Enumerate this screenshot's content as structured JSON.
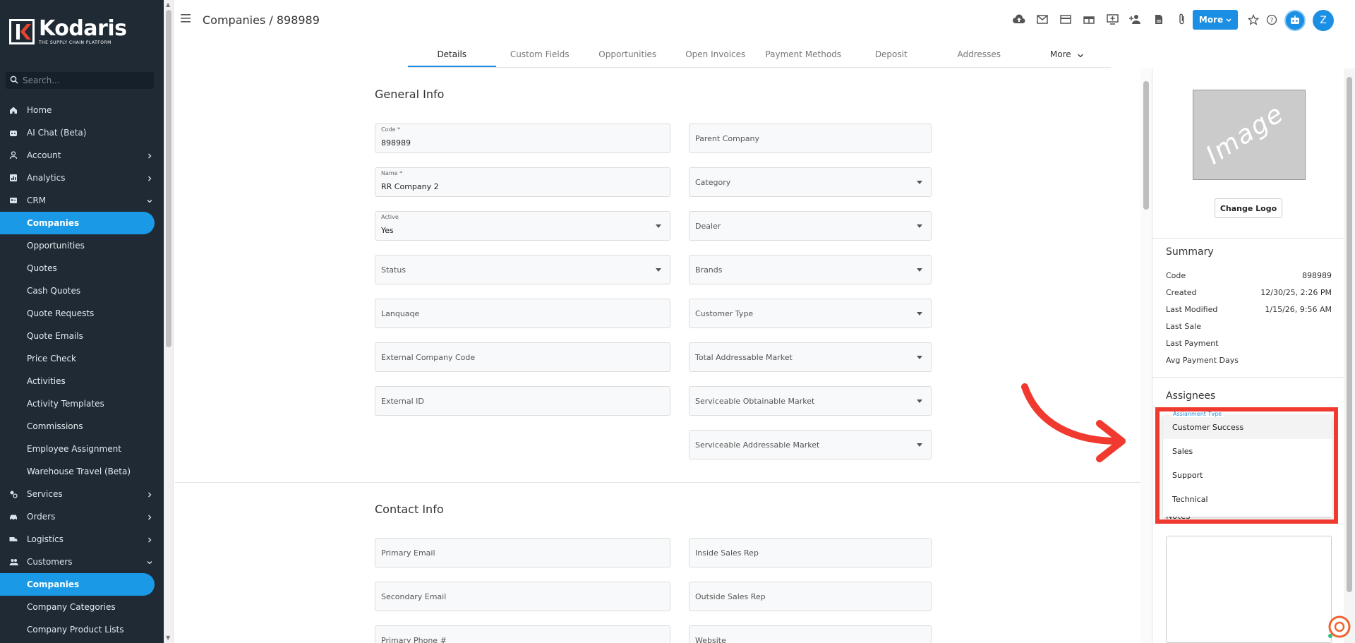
{
  "app": {
    "brand_name": "Kodaris",
    "brand_tagline": "THE SUPPLY CHAIN PLATFORM",
    "page_title": "Companies / 898989",
    "user_initial": "Z",
    "accent_color": "#1a8fe3"
  },
  "sidebar": {
    "search_placeholder": "Search...",
    "items": [
      {
        "label": "Home",
        "icon": "home-icon",
        "type": "top"
      },
      {
        "label": "AI Chat (Beta)",
        "icon": "robot-icon",
        "type": "top"
      },
      {
        "label": "Account",
        "icon": "person-icon",
        "type": "top",
        "chevron": "right"
      },
      {
        "label": "Analytics",
        "icon": "chart-icon",
        "type": "top",
        "chevron": "right"
      },
      {
        "label": "CRM",
        "icon": "contact-card-icon",
        "type": "top",
        "chevron": "down"
      },
      {
        "label": "Companies",
        "type": "sub",
        "active": true
      },
      {
        "label": "Opportunities",
        "type": "sub"
      },
      {
        "label": "Quotes",
        "type": "sub"
      },
      {
        "label": "Cash Quotes",
        "type": "sub"
      },
      {
        "label": "Quote Requests",
        "type": "sub"
      },
      {
        "label": "Quote Emails",
        "type": "sub"
      },
      {
        "label": "Price Check",
        "type": "sub"
      },
      {
        "label": "Activities",
        "type": "sub"
      },
      {
        "label": "Activity Templates",
        "type": "sub"
      },
      {
        "label": "Commissions",
        "type": "sub"
      },
      {
        "label": "Employee Assignment",
        "type": "sub"
      },
      {
        "label": "Warehouse Travel (Beta)",
        "type": "sub"
      },
      {
        "label": "Services",
        "icon": "services-icon",
        "type": "top",
        "chevron": "right"
      },
      {
        "label": "Orders",
        "icon": "car-icon",
        "type": "top",
        "chevron": "right"
      },
      {
        "label": "Logistics",
        "icon": "truck-icon",
        "type": "top",
        "chevron": "right"
      },
      {
        "label": "Customers",
        "icon": "people-icon",
        "type": "top",
        "chevron": "down"
      },
      {
        "label": "Companies",
        "type": "sub",
        "active": true
      },
      {
        "label": "Company Categories",
        "type": "sub"
      },
      {
        "label": "Company Product Lists",
        "type": "sub"
      }
    ]
  },
  "header": {
    "more_label": "More",
    "icons": [
      "cloud-upload-icon",
      "mail-icon",
      "payment-card-icon",
      "gift-box-icon",
      "monitor-icon",
      "add-person-icon",
      "document-icon",
      "paperclip-icon"
    ]
  },
  "tabs": [
    {
      "label": "Details",
      "active": true
    },
    {
      "label": "Custom Fields"
    },
    {
      "label": "Opportunities"
    },
    {
      "label": "Open Invoices"
    },
    {
      "label": "Payment Methods"
    },
    {
      "label": "Deposit"
    },
    {
      "label": "Addresses"
    },
    {
      "label": "More",
      "has_chevron": true
    }
  ],
  "general_info": {
    "title": "General Info",
    "left_fields": [
      {
        "label": "Code *",
        "value": "898989"
      },
      {
        "label": "Name *",
        "value": "RR Company 2"
      },
      {
        "label": "Active",
        "value": "Yes",
        "dropdown": true
      },
      {
        "placeholder": "Status",
        "dropdown": true
      },
      {
        "placeholder": "Lanquaqe"
      },
      {
        "placeholder": "External Company Code"
      },
      {
        "placeholder": "External ID"
      }
    ],
    "right_fields": [
      {
        "placeholder": "Parent Company"
      },
      {
        "placeholder": "Category",
        "dropdown": true
      },
      {
        "placeholder": "Dealer",
        "dropdown": true
      },
      {
        "placeholder": "Brands",
        "dropdown": true
      },
      {
        "placeholder": "Customer Type",
        "dropdown": true
      },
      {
        "placeholder": "Total Addressable Market",
        "dropdown": true
      },
      {
        "placeholder": "Serviceable Obtainable Market",
        "dropdown": true
      },
      {
        "placeholder": "Serviceable Addressable Market",
        "dropdown": true
      }
    ]
  },
  "contact_info": {
    "title": "Contact Info",
    "left_fields": [
      "Primary Email",
      "Secondary Email",
      "Primary Phone #"
    ],
    "right_fields": [
      "Inside Sales Rep",
      "Outside Sales Rep",
      "Website"
    ]
  },
  "right_panel": {
    "image_placeholder": "Image",
    "change_logo_label": "Change Logo",
    "summary_title": "Summary",
    "summary": [
      {
        "label": "Code",
        "value": "898989"
      },
      {
        "label": "Created",
        "value": "12/30/25, 2:26 PM"
      },
      {
        "label": "Last Modified",
        "value": "1/15/26, 9:56 AM"
      },
      {
        "label": "Last Sale",
        "value": ""
      },
      {
        "label": "Last Payment",
        "value": ""
      },
      {
        "label": "Avg Payment Days",
        "value": ""
      }
    ],
    "assignees_title": "Assignees",
    "assignment_type_label": "Assianment Tvpe",
    "assignment_options": [
      "Customer Success",
      "Sales",
      "Support",
      "Technical"
    ],
    "notes_label": "Notes"
  },
  "annotation": {
    "highlight_color": "#f03a2f"
  }
}
